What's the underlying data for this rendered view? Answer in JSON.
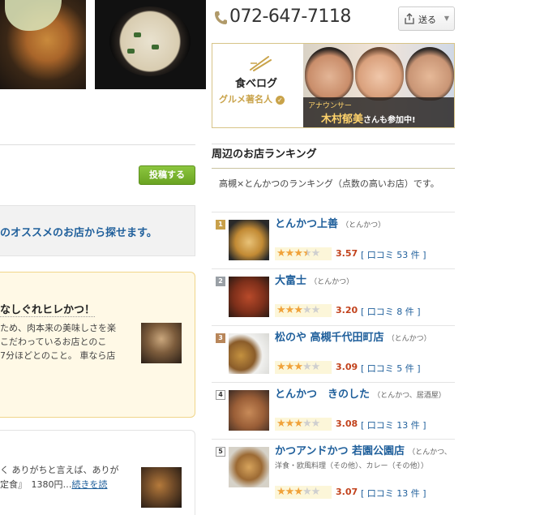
{
  "header": {
    "phone": "072-647-7118",
    "send_label": "送る"
  },
  "banner": {
    "logo": "食べログ",
    "celebrity_label": "グルメ著名人",
    "role": "アナウンサー",
    "name": "木村郁美",
    "suffix": "さんも参加中!"
  },
  "left": {
    "post_button": "投稿する",
    "search_text": "のオススメのお店から探せます。",
    "featured_review": {
      "title": "なしぐれヒレかつ！",
      "lines": [
        "ため、肉本来の美味しさを楽",
        "こだわっているお店とのこ",
        "7分ほどとのこと。 車なら店"
      ]
    },
    "plain_review": {
      "lines": [
        "く ありがちと言えば、ありが",
        "定食』　1380円…"
      ],
      "more_link": "続きを読"
    }
  },
  "ranking": {
    "heading": "周辺のお店ランキング",
    "description": "高槻×とんかつのランキング（点数の高いお店）です。",
    "reviews_prefix": "[ 口コミ",
    "reviews_suffix": "件 ]",
    "items": [
      {
        "rank": "1",
        "name": "とんかつ上善",
        "genre": "（とんかつ）",
        "score": 3.57,
        "reviews": "53",
        "medal": "gold"
      },
      {
        "rank": "2",
        "name": "大富士",
        "genre": "（とんかつ）",
        "score": 3.2,
        "reviews": "8",
        "medal": "silver"
      },
      {
        "rank": "3",
        "name": "松のや 高槻千代田町店",
        "genre": "（とんかつ）",
        "score": 3.09,
        "reviews": "5",
        "medal": "bronze"
      },
      {
        "rank": "4",
        "name": "とんかつ　きのした",
        "genre": "（とんかつ、居酒屋）",
        "score": 3.08,
        "reviews": "13",
        "medal": "plain"
      },
      {
        "rank": "5",
        "name": "かつアンドかつ 若園公園店",
        "genre": "（とんかつ、洋食・欧風料理（その他）、カレー（その他））",
        "score": 3.07,
        "reviews": "13",
        "medal": "plain"
      }
    ]
  }
}
